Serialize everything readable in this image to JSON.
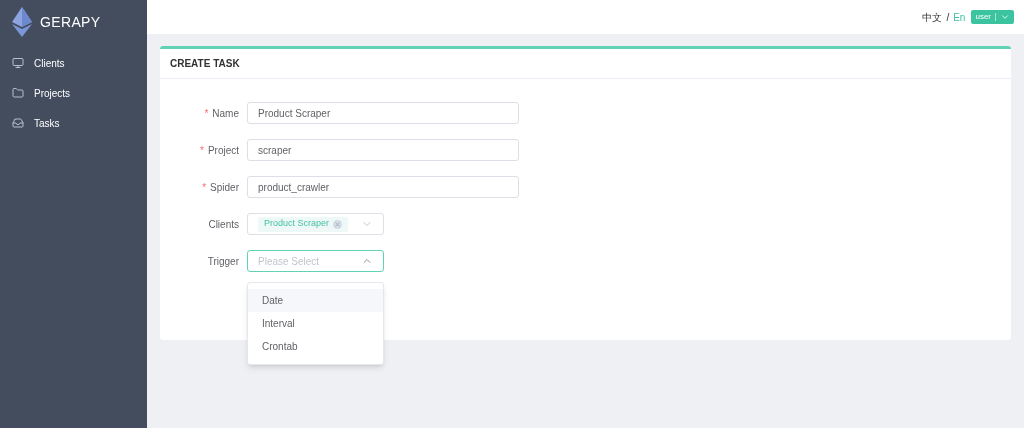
{
  "sidebar": {
    "logo": "GERAPY",
    "items": [
      {
        "label": "Clients",
        "kind": "monitor"
      },
      {
        "label": "Projects",
        "kind": "folder"
      },
      {
        "label": "Tasks",
        "kind": "tray"
      }
    ]
  },
  "header": {
    "languages": [
      {
        "label": "中文",
        "selected": false
      },
      {
        "label": "En",
        "selected": true
      }
    ],
    "separator": "/",
    "user": "user"
  },
  "card": {
    "title": "CREATE TASK",
    "required_mark": "*",
    "fields": [
      {
        "label": "Name",
        "kind": "input",
        "required": true,
        "value": "Product Scraper"
      },
      {
        "label": "Project",
        "kind": "input",
        "required": true,
        "value": "scraper"
      },
      {
        "label": "Spider",
        "kind": "input",
        "required": true,
        "value": "product_crawler"
      },
      {
        "label": "Clients",
        "kind": "multiselect",
        "required": false,
        "tags": [
          "Product Scraper"
        ]
      },
      {
        "label": "Trigger",
        "kind": "select",
        "required": false,
        "placeholder": "Please Select",
        "expanded": true,
        "options": [
          {
            "label": "Date",
            "highlighted": true
          },
          {
            "label": "Interval",
            "highlighted": false
          },
          {
            "label": "Crontab",
            "highlighted": false
          }
        ]
      }
    ]
  }
}
